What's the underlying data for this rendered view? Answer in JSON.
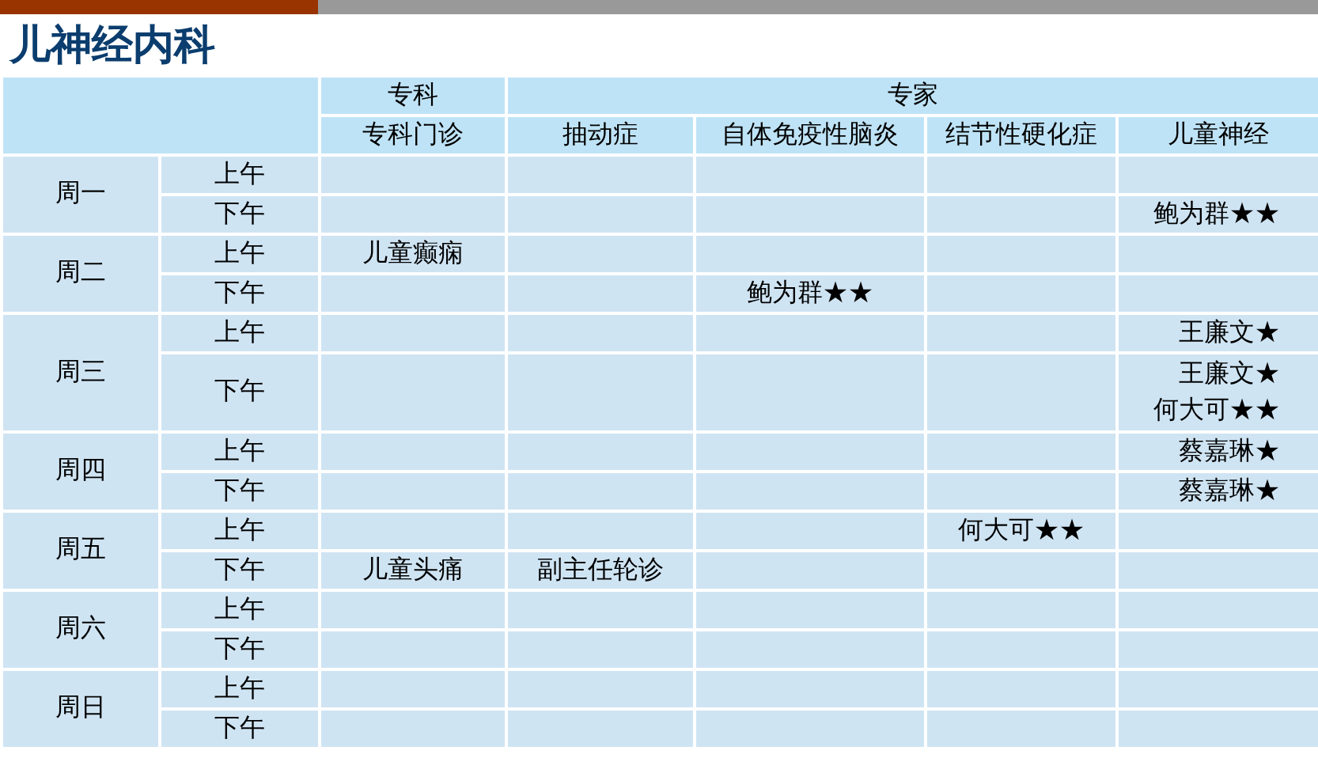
{
  "title": "儿神经内科",
  "header": {
    "groups": [
      {
        "label": "专科"
      },
      {
        "label": "专家"
      }
    ],
    "columns": [
      "专科门诊",
      "抽动症",
      "自体免疫性脑炎",
      "结节性硬化症",
      "儿童神经"
    ]
  },
  "days": [
    {
      "day": "周一",
      "slots": [
        {
          "label": "上午",
          "cells": [
            {},
            {},
            {},
            {},
            {}
          ]
        },
        {
          "label": "下午",
          "cells": [
            {},
            {},
            {},
            {},
            {
              "lines": [
                "鲍为群★★"
              ]
            }
          ]
        }
      ]
    },
    {
      "day": "周二",
      "slots": [
        {
          "label": "上午",
          "cells": [
            {
              "lines": [
                "儿童癫痫"
              ]
            },
            {},
            {},
            {},
            {}
          ]
        },
        {
          "label": "下午",
          "cells": [
            {},
            {},
            {
              "lines": [
                "鲍为群★★"
              ]
            },
            {},
            {}
          ]
        }
      ]
    },
    {
      "day": "周三",
      "slots": [
        {
          "label": "上午",
          "cells": [
            {},
            {},
            {},
            {},
            {
              "lines": [
                "王廉文★"
              ]
            }
          ]
        },
        {
          "label": "下午",
          "cells": [
            {},
            {},
            {},
            {},
            {
              "lines": [
                "王廉文★",
                "何大可★★"
              ]
            }
          ]
        }
      ]
    },
    {
      "day": "周四",
      "slots": [
        {
          "label": "上午",
          "cells": [
            {},
            {},
            {},
            {},
            {
              "lines": [
                "蔡嘉琳★"
              ]
            }
          ]
        },
        {
          "label": "下午",
          "cells": [
            {},
            {},
            {},
            {},
            {
              "lines": [
                "蔡嘉琳★"
              ]
            }
          ]
        }
      ]
    },
    {
      "day": "周五",
      "slots": [
        {
          "label": "上午",
          "cells": [
            {},
            {},
            {},
            {
              "lines": [
                "何大可★★"
              ]
            },
            {}
          ]
        },
        {
          "label": "下午",
          "cells": [
            {
              "lines": [
                "儿童头痛"
              ]
            },
            {
              "lines": [
                "副主任轮诊"
              ]
            },
            {},
            {},
            {}
          ]
        }
      ]
    },
    {
      "day": "周六",
      "slots": [
        {
          "label": "上午",
          "cells": [
            {},
            {},
            {},
            {},
            {}
          ]
        },
        {
          "label": "下午",
          "cells": [
            {},
            {},
            {},
            {},
            {}
          ]
        }
      ]
    },
    {
      "day": "周日",
      "slots": [
        {
          "label": "上午",
          "cells": [
            {},
            {},
            {},
            {},
            {}
          ]
        },
        {
          "label": "下午",
          "cells": [
            {},
            {},
            {},
            {},
            {}
          ]
        }
      ]
    }
  ]
}
